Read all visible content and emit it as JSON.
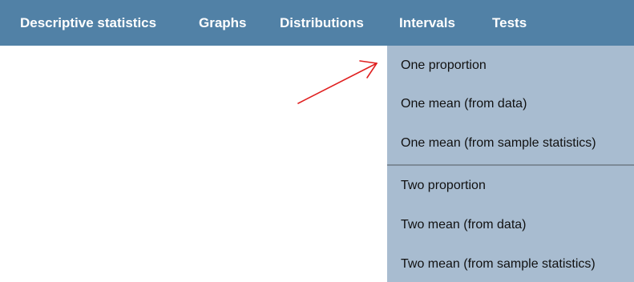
{
  "menu": {
    "items": [
      {
        "label": "Descriptive statistics"
      },
      {
        "label": "Graphs"
      },
      {
        "label": "Distributions"
      },
      {
        "label": "Intervals"
      },
      {
        "label": "Tests"
      }
    ]
  },
  "dropdown": {
    "items": [
      {
        "label": "One proportion"
      },
      {
        "label": "One mean (from data)"
      },
      {
        "label": "One mean (from sample statistics)"
      },
      {
        "label": "Two proportion"
      },
      {
        "label": "Two mean (from data)"
      },
      {
        "label": "Two mean (from sample statistics)"
      }
    ]
  },
  "colors": {
    "navbar": "#5181a6",
    "dropdown": "#a8bcd0",
    "annotation_arrow": "#e02020"
  }
}
